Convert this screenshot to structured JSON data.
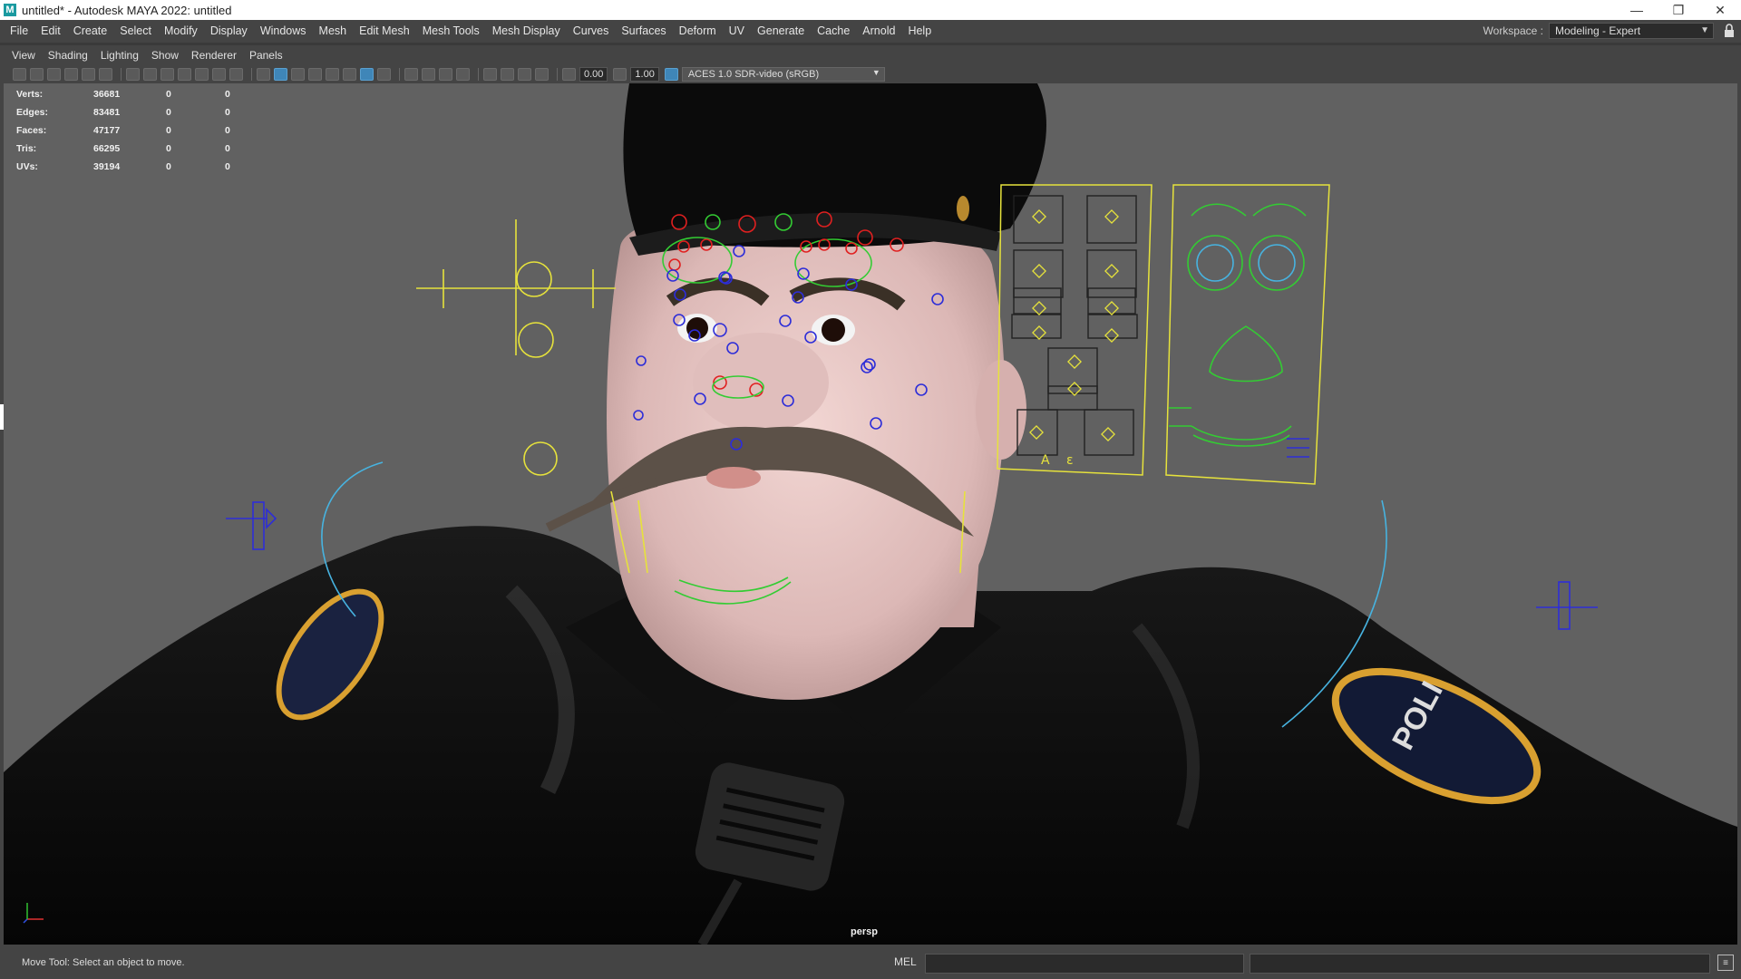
{
  "window": {
    "title": "untitled* - Autodesk MAYA 2022: untitled",
    "logo_letter": "M",
    "controls": [
      "—",
      "❐",
      "✕"
    ]
  },
  "menubar": {
    "items": [
      "File",
      "Edit",
      "Create",
      "Select",
      "Modify",
      "Display",
      "Windows",
      "Mesh",
      "Edit Mesh",
      "Mesh Tools",
      "Mesh Display",
      "Curves",
      "Surfaces",
      "Deform",
      "UV",
      "Generate",
      "Cache",
      "Arnold",
      "Help"
    ],
    "workspace_label": "Workspace :",
    "workspace_value": "Modeling - Expert"
  },
  "panel_menu": {
    "items": [
      "View",
      "Shading",
      "Lighting",
      "Show",
      "Renderer",
      "Panels"
    ]
  },
  "toolbar": {
    "near_value": "0.00",
    "far_value": "1.00",
    "color_space": "ACES 1.0 SDR-video (sRGB)"
  },
  "hud": {
    "rows": [
      {
        "label": "Verts:",
        "value": "36681",
        "c1": "0",
        "c2": "0"
      },
      {
        "label": "Edges:",
        "value": "83481",
        "c1": "0",
        "c2": "0"
      },
      {
        "label": "Faces:",
        "value": "47177",
        "c1": "0",
        "c2": "0"
      },
      {
        "label": "Tris:",
        "value": "66295",
        "c1": "0",
        "c2": "0"
      },
      {
        "label": "UVs:",
        "value": "39194",
        "c1": "0",
        "c2": "0"
      }
    ]
  },
  "viewport": {
    "camera": "persp",
    "face_panel_labels": [
      "A",
      "ε"
    ]
  },
  "status": {
    "help_text": "Move Tool: Select an object to move.",
    "mel_label": "MEL"
  },
  "colors": {
    "rig_yellow": "#e6e23c",
    "rig_green": "#33cc33",
    "rig_red": "#e02020",
    "rig_blue": "#2d2dd8",
    "rig_cyan": "#47b3e0"
  }
}
